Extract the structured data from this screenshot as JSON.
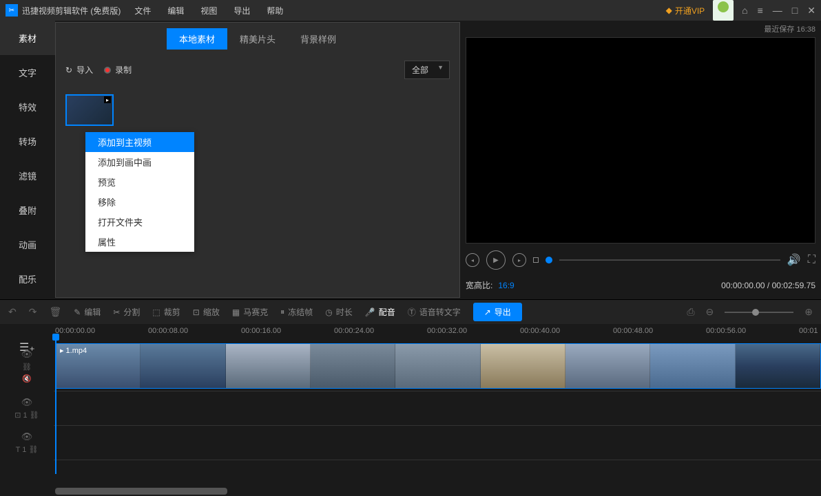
{
  "app": {
    "title": "迅捷视频剪辑软件 (免费版)"
  },
  "menu": {
    "file": "文件",
    "edit": "编辑",
    "view": "视图",
    "export": "导出",
    "help": "帮助"
  },
  "titlebar": {
    "vip": "开通VIP",
    "save_label": "最近保存",
    "save_time": "16:38"
  },
  "nav": {
    "material": "素材",
    "text": "文字",
    "effect": "特效",
    "transition": "转场",
    "filter": "滤镜",
    "overlay": "叠附",
    "animation": "动画",
    "music": "配乐"
  },
  "tabs": {
    "local": "本地素材",
    "intro": "精美片头",
    "bg": "背景样例"
  },
  "media": {
    "import": "导入",
    "record": "录制",
    "filter_all": "全部"
  },
  "context": {
    "add_main": "添加到主视频",
    "add_pip": "添加到画中画",
    "preview": "预览",
    "remove": "移除",
    "open_folder": "打开文件夹",
    "props": "属性"
  },
  "preview": {
    "ratio_label": "宽高比:",
    "ratio_value": "16:9",
    "current_time": "00:00:00.00",
    "total_time": "00:02:59.75"
  },
  "toolbar": {
    "edit": "编辑",
    "split": "分割",
    "crop": "裁剪",
    "zoom": "缩放",
    "mosaic": "马赛克",
    "freeze": "冻结帧",
    "duration": "时长",
    "dub": "配音",
    "stt": "语音转文字",
    "export": "导出"
  },
  "timeline": {
    "marks": [
      "00:00:00.00",
      "00:00:08.00",
      "00:00:16.00",
      "00:00:24.00",
      "00:00:32.00",
      "00:00:40.00",
      "00:00:48.00",
      "00:00:56.00",
      "00:01"
    ],
    "clip_name": "1.mp4"
  }
}
